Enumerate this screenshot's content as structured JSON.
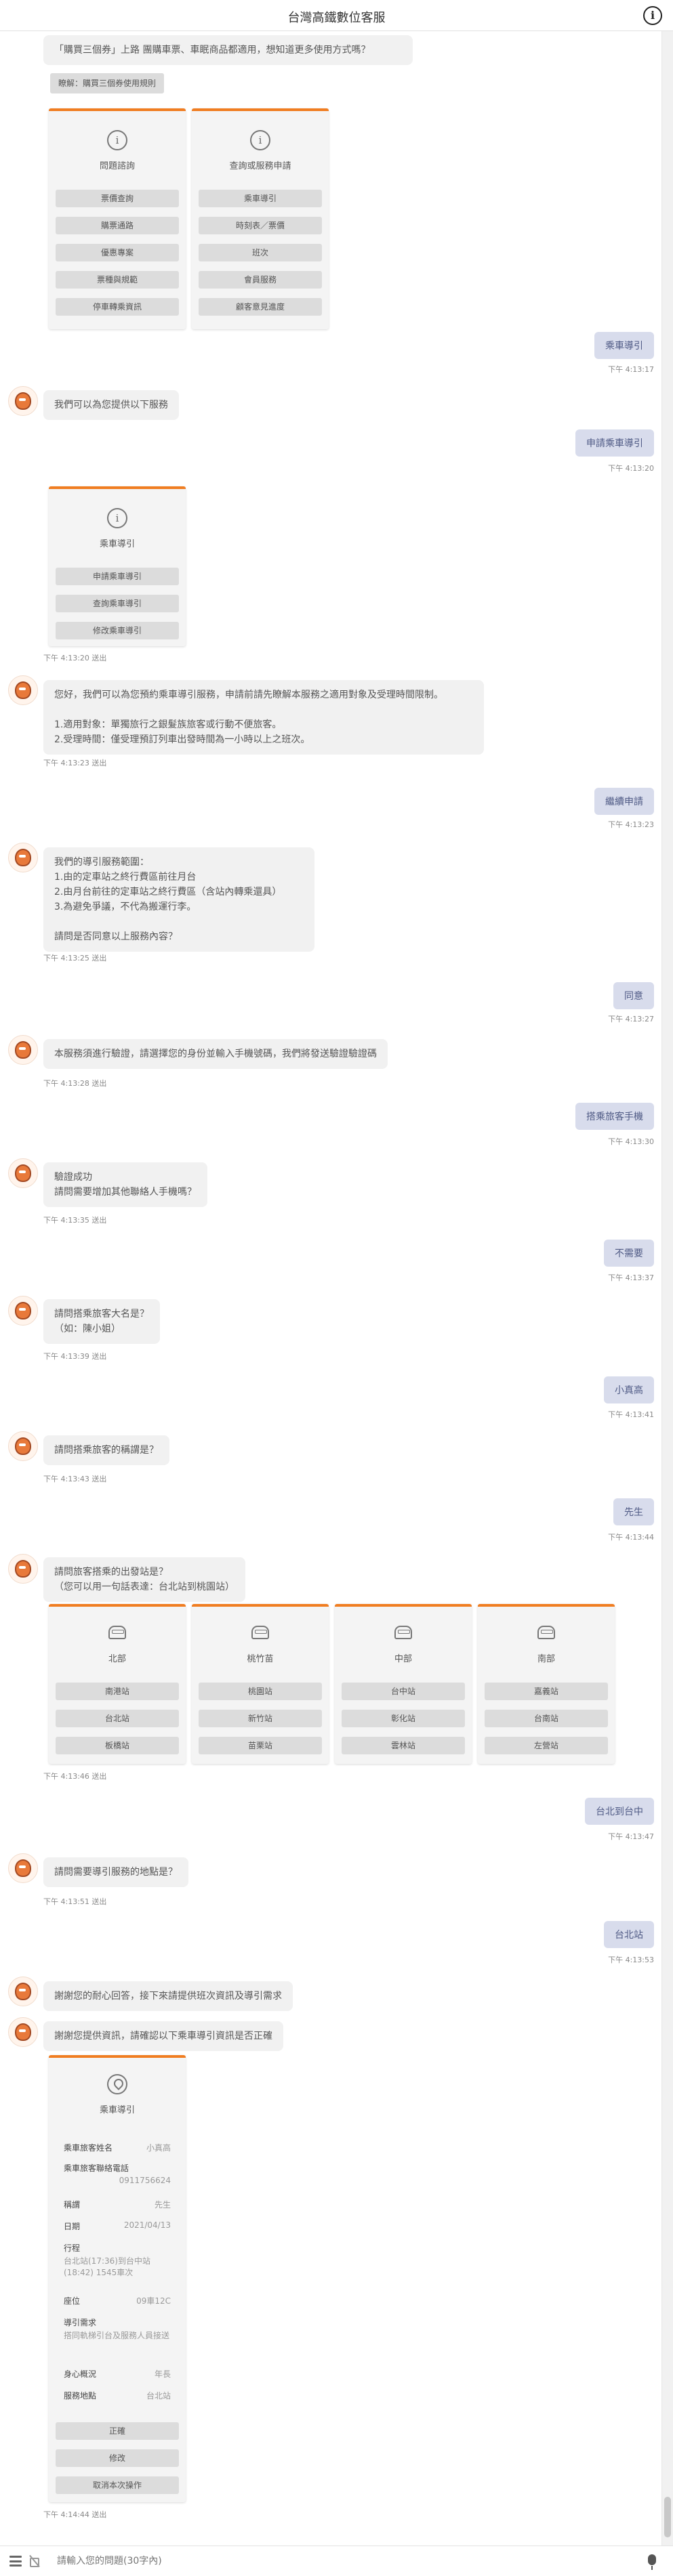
{
  "header": {
    "title": "台灣高鐵數位客服",
    "info_icon": "info-icon"
  },
  "messages": {
    "m0": "「購買三個券」上路 團購車票、車眠商品都適用，想知道更多使用方式嗎？",
    "m0_button": "瞭解：購買三個券使用規則",
    "m1": "我們可以為您提供以下服務",
    "m2": "您好，我們可以為您預約乘車導引服務，申請前請先瞭解本服務之適用對象及受理時間限制。\n\n1.適用對象：單獨旅行之銀髮族旅客或行動不便旅客。\n2.受理時間：僅受理預訂列車出發時間為一小時以上之班次。",
    "m3": "我們的導引服務範圍：\n1.由的定車站之終行費區前往月台\n2.由月台前往的定車站之終行費區（含站內轉乘還具）\n3.為避免爭議，不代為搬運行李。\n\n請問是否同意以上服務內容？",
    "m4": "本服務須進行驗證，請選擇您的身份並輸入手機號碼，我們將發送驗證驗證碼",
    "m5": "驗證成功\n請問需要增加其他聯絡人手機嗎？",
    "m6": "請問搭乘旅客大名是？\n（如：陳小姐）",
    "m7": "請問搭乘旅客的稱謂是？",
    "m8": "請問旅客搭乘的出發站是？\n（您可以用一句話表達：台北站到桃園站）",
    "m9": "請問需要導引服務的地點是？",
    "m10": "謝謝您的耐心回答，接下來請提供班次資訊及導引需求",
    "m11": "謝謝您提供資訊，請確認以下乘車導引資訊是否正確"
  },
  "user_messages": {
    "u1": "乘車導引",
    "u2": "申請乘車導引",
    "u3": "繼續申請",
    "u4": "同意",
    "u5": "搭乘旅客手機",
    "u6": "不需要",
    "u7": "小真高",
    "u8": "先生",
    "u9": "台北到台中",
    "u10": "台北站"
  },
  "times": {
    "t1": "下午 4:13:17",
    "t2": "下午 4:13:20",
    "t3": "下午 4:13:20 送出",
    "t4": "下午 4:13:23 送出",
    "t5": "下午 4:13:23",
    "t6": "下午 4:13:25 送出",
    "t7": "下午 4:13:27",
    "t8": "下午 4:13:28 送出",
    "t9": "下午 4:13:30",
    "t10": "下午 4:13:35 送出",
    "t11": "下午 4:13:37",
    "t12": "下午 4:13:39 送出",
    "t13": "下午 4:13:41",
    "t14": "下午 4:13:43 送出",
    "t15": "下午 4:13:44",
    "t16": "下午 4:13:46 送出",
    "t17": "下午 4:13:47",
    "t18": "下午 4:13:51 送出",
    "t19": "下午 4:13:53",
    "t20": "下午 4:14:44 送出"
  },
  "service_cards": [
    {
      "title": "問題諮詢",
      "icon": "info-icon",
      "buttons": [
        "票價查詢",
        "購票通路",
        "優惠專案",
        "票種與規範",
        "停車轉乘資訊"
      ]
    },
    {
      "title": "查詢或服務申請",
      "icon": "info-icon",
      "buttons": [
        "乘車導引",
        "時刻表／票價",
        "班次",
        "會員服務",
        "顧客意見進度"
      ]
    }
  ],
  "guide_card": {
    "title": "乘車導引",
    "icon": "info-icon",
    "buttons": [
      "申請乘車導引",
      "查詢乘車導引",
      "修改乘車導引"
    ]
  },
  "station_cards": [
    {
      "title": "北部",
      "icon": "train-icon",
      "buttons": [
        "南港站",
        "台北站",
        "板橋站"
      ]
    },
    {
      "title": "桃竹苗",
      "icon": "train-icon",
      "buttons": [
        "桃園站",
        "新竹站",
        "苗栗站"
      ]
    },
    {
      "title": "中部",
      "icon": "train-icon",
      "buttons": [
        "台中站",
        "彰化站",
        "雲林站"
      ]
    },
    {
      "title": "南部",
      "icon": "train-icon",
      "buttons": [
        "嘉義站",
        "台南站",
        "左營站"
      ]
    }
  ],
  "summary_card": {
    "title": "乘車導引",
    "icon": "pin-icon",
    "name_label": "乘車旅客姓名",
    "name_value": "小真高",
    "phone_label": "乘車旅客聯絡電話",
    "phone_value": "0911756624",
    "title_label": "稱謂",
    "title_value": "先生",
    "date_label": "日期",
    "date_value": "2021/04/13",
    "trip_label": "行程",
    "trip_value": "台北站(17:36)到台中站(18:42) 1545車次",
    "seat_label": "座位",
    "seat_value": "09車12C",
    "need_label": "導引需求",
    "need_value": "搭同軌梯引台及服務人員接送",
    "body_label": "身心概況",
    "body_value": "年長",
    "place_label": "服務地點",
    "place_value": "台北站",
    "buttons": [
      "正確",
      "修改",
      "取消本次操作"
    ]
  },
  "input": {
    "placeholder": "請輸入您的問題(30字內)"
  },
  "colors": {
    "accent": "#f07d21",
    "user_bubble": "#d8dcec",
    "bot_bubble": "#f1f1f1"
  }
}
